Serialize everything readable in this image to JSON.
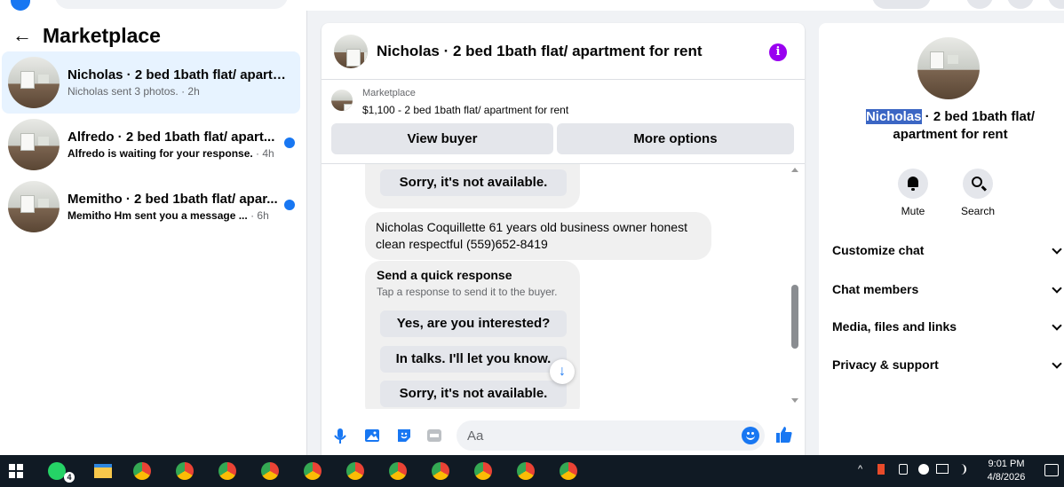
{
  "marketplace": {
    "title": "Marketplace",
    "back_icon": "←"
  },
  "conversations": [
    {
      "name": "Nicholas · 2 bed 1bath flat/ apartm...",
      "preview": "Nicholas sent 3 photos.",
      "time": " · 2h",
      "unread": false
    },
    {
      "name": "Alfredo · 2 bed 1bath flat/ apart...",
      "preview": "Alfredo is waiting for your response.",
      "time": " · 4h",
      "unread": true
    },
    {
      "name": "Memitho · 2 bed 1bath flat/ apar...",
      "preview": "Memitho Hm sent you a message ...",
      "time": " · 6h",
      "unread": true
    }
  ],
  "chat": {
    "title": "Nicholas · 2 bed 1bath flat/ apartment for rent",
    "info_icon": "i",
    "card": {
      "label": "Marketplace",
      "price_line": "$1,100 - 2 bed 1bath flat/ apartment for rent",
      "view_buyer": "View buyer",
      "more_options": "More options"
    },
    "messages": {
      "sorry_top": "Sorry, it's not available.",
      "buyer_text": "Nicholas Coquillette 61 years old business owner honest clean respectful (559)652-8419",
      "quick_title": "Send a quick response",
      "quick_sub": "Tap a response to send it to the buyer.",
      "quick_options": [
        "Yes, are you interested?",
        "In talks. I'll let you know.",
        "Sorry, it's not available."
      ]
    },
    "scroll_down_icon": "↓",
    "composer": {
      "placeholder": "Aa"
    }
  },
  "details": {
    "title_highlight": "Nicholas",
    "title_rest": " · 2 bed 1bath flat/ apartment for rent",
    "actions": [
      {
        "label": "Mute"
      },
      {
        "label": "Search"
      }
    ],
    "sections": [
      "Customize chat",
      "Chat members",
      "Media, files and links",
      "Privacy & support"
    ]
  },
  "taskbar": {
    "whatsapp_badge": "4",
    "clock_time": "9:01 PM",
    "clock_date": "4/8/2026"
  },
  "colors": {
    "accent": "#1877f2",
    "active_conversation": "#e7f3ff",
    "info": "#9900f0",
    "taskbar": "#101a24"
  }
}
